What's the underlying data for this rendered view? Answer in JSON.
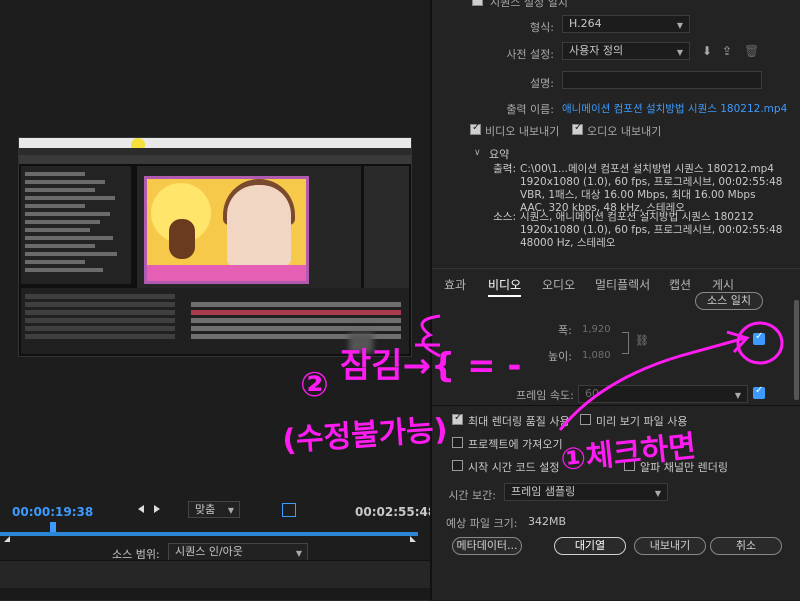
{
  "export_settings": {
    "match_sequence_label": "시퀀스 설정 일치",
    "format_label": "형식:",
    "format_value": "H.264",
    "preset_label": "사전 설정:",
    "preset_value": "사용자 정의",
    "comments_label": "설명:",
    "comments_value": "",
    "output_name_label": "출력 이름:",
    "output_name_value": "애니메이션 컴포션 설치방법 시퀀스 180212.mp4",
    "export_video_label": "비디오 내보내기",
    "export_audio_label": "오디오 내보내기"
  },
  "summary": {
    "title": "요약",
    "output_label": "출력:",
    "output_lines": [
      "C:\\00\\1...메이션 컴포션 설치방법 시퀀스 180212.mp4",
      "1920x1080 (1.0), 60 fps, 프로그레시브, 00:02:55:48",
      "VBR, 1패스, 대상 16.00 Mbps, 최대 16.00 Mbps",
      "AAC, 320 kbps, 48 kHz, 스테레오"
    ],
    "source_label": "소스:",
    "source_lines": [
      "시퀀스, 애니메이션 컴포션 설치방법 시퀀스 180212",
      "1920x1080 (1.0), 60 fps, 프로그레시브, 00:02:55:48",
      "48000 Hz, 스테레오"
    ]
  },
  "tabs": [
    {
      "label": "효과"
    },
    {
      "label": "비디오"
    },
    {
      "label": "오디오"
    },
    {
      "label": "멀티플렉서"
    },
    {
      "label": "캡션"
    },
    {
      "label": "게시"
    }
  ],
  "video": {
    "match_source_label": "소스 일치",
    "width_label": "폭:",
    "width_value": "1,920",
    "height_label": "높이:",
    "height_value": "1,080",
    "frame_rate_label": "프레임 속도:",
    "frame_rate_value": "60"
  },
  "options": {
    "max_render_quality": "최대 렌더링 품질 사용",
    "use_previews": "미리 보기 파일 사용",
    "import_into_project": "프로젝트에 가져오기",
    "set_start_timecode": "시작 시간 코드 설정",
    "render_alpha": "알파 채널만 렌더링",
    "time_interpolation_label": "시간 보간:",
    "time_interpolation_value": "프레임 샘플링",
    "file_size_label": "예상 파일 크기:",
    "file_size_value": "342MB"
  },
  "buttons": {
    "metadata": "메타데이터...",
    "queue": "대기열",
    "export": "내보내기",
    "cancel": "취소"
  },
  "preview": {
    "current_time": "00:00:19:38",
    "end_time": "00:02:55:48",
    "fit_value": "맞춤",
    "source_range_label": "소스 범위:",
    "source_range_value": "시퀀스 인/아웃"
  },
  "annotations": {
    "circle_two": "②",
    "locked_text": "잠김→{ = -",
    "not_editable": "(수정불가능)",
    "check_then": "①체크하면"
  },
  "colors": {
    "accent_blue": "#3d9bff",
    "annotation_magenta": "#ff1cf2"
  }
}
